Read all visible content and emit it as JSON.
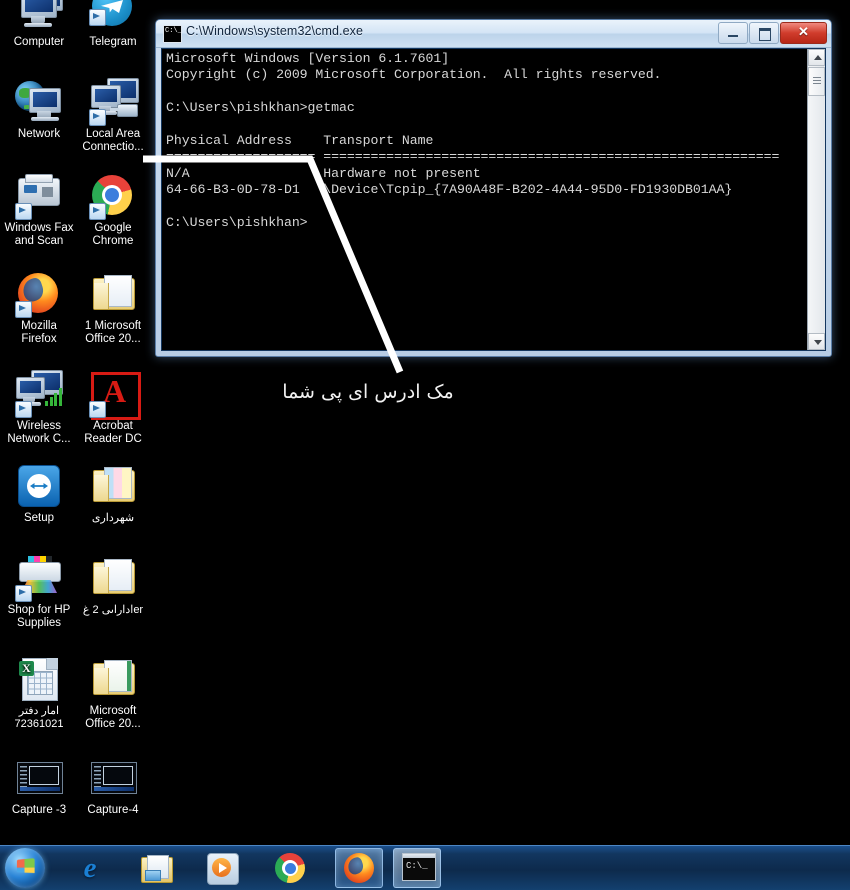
{
  "desktop": {
    "icons": [
      {
        "label": "Computer",
        "icon": "computer-icon",
        "rtl": false
      },
      {
        "label": "Telegram",
        "icon": "telegram-icon",
        "rtl": false
      },
      {
        "label": "Network",
        "icon": "network-icon",
        "rtl": false
      },
      {
        "label": "Local Area Connectio...",
        "icon": "local-area-connection-icon",
        "rtl": false
      },
      {
        "label": "Windows Fax and Scan",
        "icon": "windows-fax-and-scan-icon",
        "rtl": false
      },
      {
        "label": "Google Chrome",
        "icon": "google-chrome-icon",
        "rtl": false
      },
      {
        "label": "Mozilla Firefox",
        "icon": "mozilla-firefox-icon",
        "rtl": false
      },
      {
        "label": "1 Microsoft Office 20...",
        "icon": "folder-icon",
        "rtl": false
      },
      {
        "label": "Wireless Network C...",
        "icon": "wireless-network-connection-icon",
        "rtl": false
      },
      {
        "label": "Acrobat Reader DC",
        "icon": "acrobat-reader-icon",
        "rtl": false
      },
      {
        "label": "Setup",
        "icon": "teamviewer-setup-icon",
        "rtl": false
      },
      {
        "label": "شهرداری",
        "icon": "folder-icon",
        "rtl": true
      },
      {
        "label": "Shop for HP Supplies",
        "icon": "hp-printer-supplies-icon",
        "rtl": false
      },
      {
        "label": "erاداراىی 2 غ",
        "icon": "folder-icon",
        "rtl": true
      },
      {
        "label": "امار دفتر 72361021",
        "icon": "excel-file-icon",
        "rtl": true
      },
      {
        "label": "Microsoft Office 20...",
        "icon": "folder-icon",
        "rtl": false
      },
      {
        "label": "Capture -3",
        "icon": "capture-image-icon",
        "rtl": false
      },
      {
        "label": "Capture-4",
        "icon": "capture-image-icon",
        "rtl": false
      }
    ]
  },
  "cmd_window": {
    "title": "C:\\Windows\\system32\\cmd.exe",
    "icon": "cmd-icon",
    "minimize_label": "Minimize",
    "maximize_label": "Maximize",
    "close_label": "Close",
    "console_text": "Microsoft Windows [Version 6.1.7601]\nCopyright (c) 2009 Microsoft Corporation.  All rights reserved.\n\nC:\\Users\\pishkhan>getmac\n\nPhysical Address    Transport Name\n=================== ==========================================================\nN/A                 Hardware not present\n64-66-B3-0D-78-D1   \\Device\\Tcpip_{7A90A48F-B202-4A44-95D0-FD1930DB01AA}\n\nC:\\Users\\pishkhan>"
  },
  "annotation": {
    "text": "مک ادرس ای پی شما",
    "line_color": "#ffffff"
  },
  "taskbar": {
    "start_label": "Start",
    "items": [
      {
        "label": "Internet Explorer",
        "icon": "internet-explorer-icon",
        "active": false
      },
      {
        "label": "Windows Explorer",
        "icon": "windows-explorer-icon",
        "active": false
      },
      {
        "label": "Windows Media Player",
        "icon": "windows-media-player-icon",
        "active": false
      },
      {
        "label": "Google Chrome",
        "icon": "google-chrome-icon",
        "active": false
      },
      {
        "label": "Mozilla Firefox",
        "icon": "mozilla-firefox-icon",
        "active": true
      },
      {
        "label": "C:\\Windows\\system32\\cmd.exe",
        "icon": "cmd-icon",
        "active": true
      }
    ]
  },
  "colors": {
    "accent": "#1b4f8c",
    "console_bg": "#000000",
    "console_text": "#d8d8d8",
    "annotation": "#ffffff",
    "highlight_box": "#d81b14"
  }
}
